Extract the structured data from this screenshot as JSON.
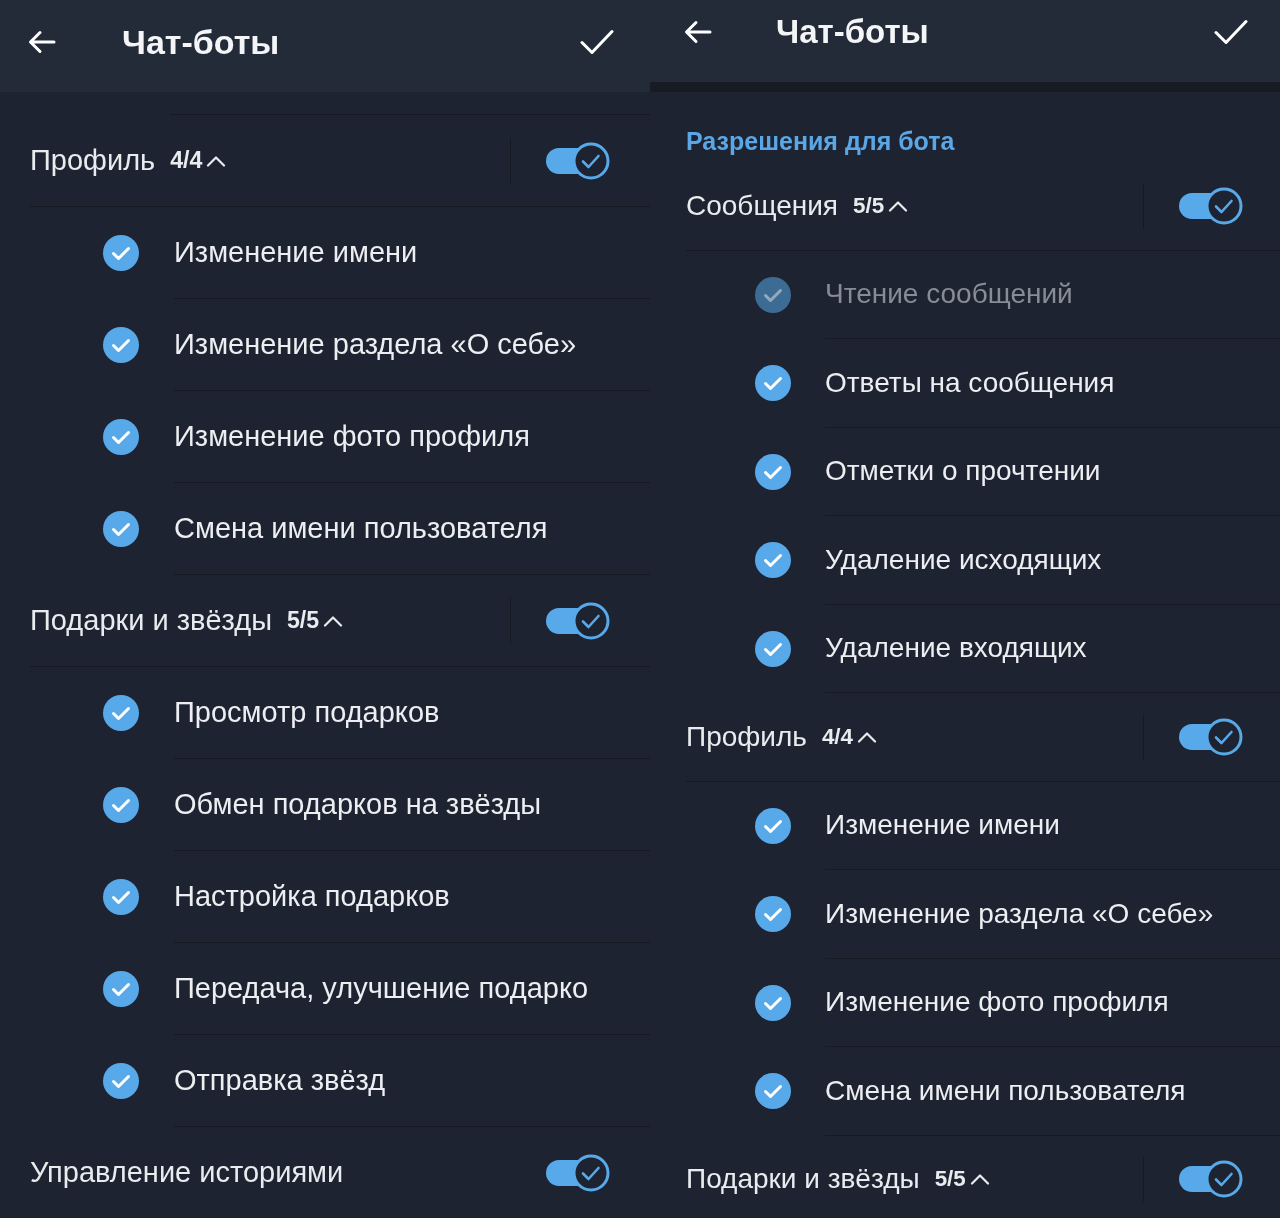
{
  "panels": [
    {
      "header": {
        "title": "Чат-боты"
      },
      "groups": [
        {
          "label": "Профиль",
          "count": "4/4",
          "expanded": true,
          "on": true,
          "items": [
            {
              "label": "Изменение имени",
              "checked": true,
              "disabled": false
            },
            {
              "label": "Изменение раздела «О себе»",
              "checked": true,
              "disabled": false
            },
            {
              "label": "Изменение фото профиля",
              "checked": true,
              "disabled": false
            },
            {
              "label": "Смена имени пользователя",
              "checked": true,
              "disabled": false
            }
          ]
        },
        {
          "label": "Подарки и звёзды",
          "count": "5/5",
          "expanded": true,
          "on": true,
          "items": [
            {
              "label": "Просмотр подарков",
              "checked": true,
              "disabled": false
            },
            {
              "label": "Обмен подарков на звёзды",
              "checked": true,
              "disabled": false
            },
            {
              "label": "Настройка подарков",
              "checked": true,
              "disabled": false
            },
            {
              "label": "Передача, улучшение подарко",
              "checked": true,
              "disabled": false
            },
            {
              "label": "Отправка звёзд",
              "checked": true,
              "disabled": false
            }
          ]
        },
        {
          "label": "Управление историями",
          "on": true
        }
      ]
    },
    {
      "header": {
        "title": "Чат-боты"
      },
      "section_title": "Разрешения для бота",
      "groups": [
        {
          "label": "Сообщения",
          "count": "5/5",
          "expanded": true,
          "on": true,
          "items": [
            {
              "label": "Чтение сообщений",
              "checked": true,
              "disabled": true
            },
            {
              "label": "Ответы на сообщения",
              "checked": true,
              "disabled": false
            },
            {
              "label": "Отметки о прочтении",
              "checked": true,
              "disabled": false
            },
            {
              "label": "Удаление исходящих",
              "checked": true,
              "disabled": false
            },
            {
              "label": "Удаление входящих",
              "checked": true,
              "disabled": false
            }
          ]
        },
        {
          "label": "Профиль",
          "count": "4/4",
          "expanded": true,
          "on": true,
          "items": [
            {
              "label": "Изменение имени",
              "checked": true,
              "disabled": false
            },
            {
              "label": "Изменение раздела «О себе»",
              "checked": true,
              "disabled": false
            },
            {
              "label": "Изменение фото профиля",
              "checked": true,
              "disabled": false
            },
            {
              "label": "Смена имени пользователя",
              "checked": true,
              "disabled": false
            }
          ]
        },
        {
          "label": "Подарки и звёзды",
          "count": "5/5",
          "expanded": true,
          "on": true
        }
      ]
    }
  ]
}
